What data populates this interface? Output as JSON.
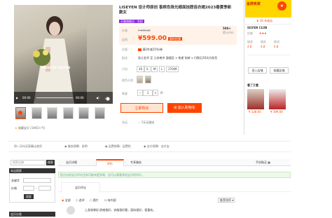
{
  "product": {
    "title_line1": "LISEYEN 设计师原创 香槟色珠光缎面挂脖连衣裙2023春夏季新",
    "title_line2": "款女",
    "badge": "天猫旗舰店 · 实拍",
    "promo_label": "促销",
    "price_label": "价格",
    "original_price": "¥ 699.00",
    "review_count": "500+",
    "review_label": "累计评价",
    "promo_price": "¥599.00",
    "promo_tag": "限时优惠",
    "coupon_label": "优惠",
    "coupon_text": "满2件减15%/券",
    "delivery_label": "配送",
    "delivery_text": "浙江金华  至  江苏南京 鼓楼区 ∨   快递 包邮 ∨   付款后30天内发货",
    "size_label": "尺码",
    "sizes": [
      "XS",
      "S",
      "M",
      "L",
      "170/M"
    ],
    "color_label": "颜色分类",
    "qty_label": "数量",
    "qty": "1",
    "qty_unit": "件",
    "buy_now": "立即购买",
    "add_cart": "加入购物车",
    "service_label": "承诺",
    "service_text": "7天无理由",
    "watermark": "MADE BY LISEYEN",
    "video_time": "00:00",
    "favorite": "收藏宝贝 (1945人气)"
  },
  "shop": {
    "brand": "金牌卖家",
    "badge_line": "16 年老店",
    "name": "SILYEN CLUB",
    "rating_label": "信誉",
    "stats": [
      {
        "label": "描述",
        "value": "4.8"
      },
      {
        "label": "服务",
        "value": "4.8"
      },
      {
        "label": "物流",
        "value": "4.8"
      }
    ],
    "enter_shop": "进入店铺",
    "fav_shop": "收藏店铺",
    "recommend_title": "看了又看",
    "rec_price1": "¥ 338.00",
    "rec_price2": "¥ 399.00"
  },
  "guarantees": [
    "同一天内买家确认收货",
    "服务保障：说明",
    "运费保障：运费险",
    "支付保障：支付宝"
  ],
  "sidebar": {
    "search_placeholder": "搜索店铺",
    "search_btn": "搜索",
    "box_title": "本店搜索",
    "keyword_label": "关键字",
    "price_label": "价格",
    "go_btn": "搜索",
    "category_title": "宝贝分类"
  },
  "tabs": {
    "items": [
      "宝贝详情",
      "评价",
      "专享服务"
    ],
    "right": "手机购买"
  },
  "notice": "您点击的宝贝评价还有可能有更多哦，也可以看看其他宝贝的评价。",
  "review_tab": "宝贝评论",
  "filters": [
    "全部",
    "追评",
    "图片",
    "有内容"
  ],
  "sort": "推荐排序",
  "review_text": "上身效果好,质感很好，衣服很好看，面料很好，很喜欢。"
}
